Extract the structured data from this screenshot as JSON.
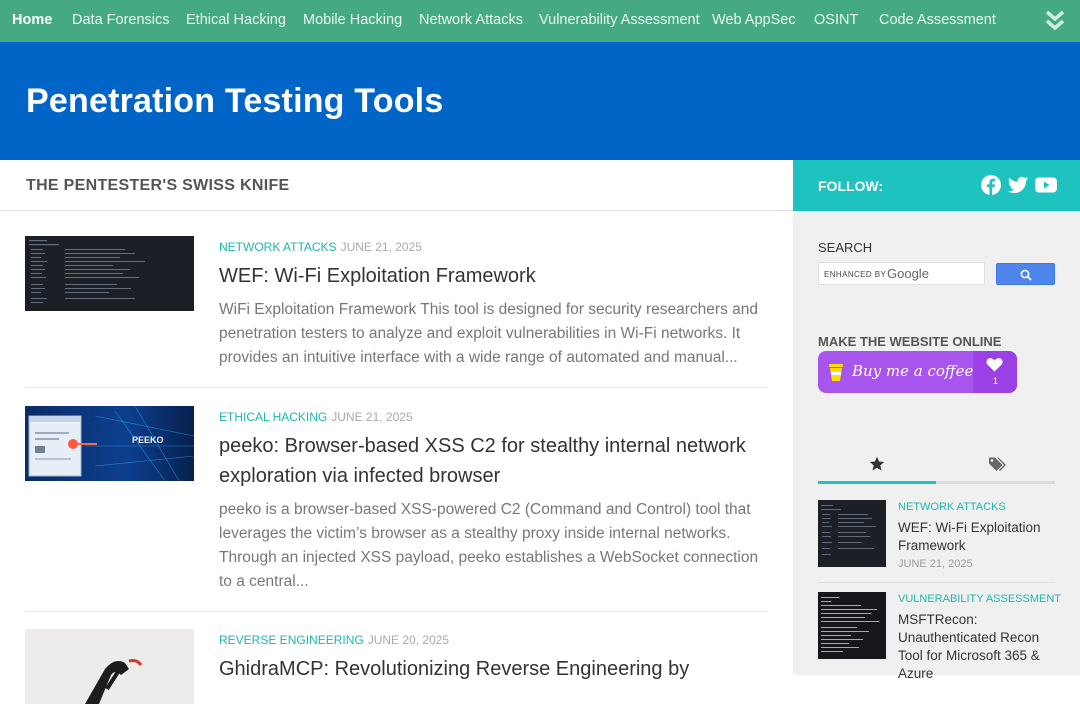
{
  "nav": {
    "items": [
      "Home",
      "Data Forensics",
      "Ethical Hacking",
      "Mobile Hacking",
      "Network Attacks",
      "Vulnerability Assessment",
      "Web AppSec",
      "OSINT",
      "Code Assessment"
    ],
    "more_icon": "double-chevron-down-icon",
    "bar_color": "#45a982"
  },
  "header": {
    "title": "Penetration Testing Tools",
    "bg_color": "#0065c6"
  },
  "main": {
    "tagline": "THE PENTESTER'S SWISS KNIFE",
    "posts": [
      {
        "category": "NETWORK ATTACKS",
        "date": "JUNE 21, 2025",
        "title": "WEF: Wi-Fi Exploitation Framework",
        "excerpt": "WiFi Exploitation Framework This tool is designed for security researchers and penetration testers to analyze and exploit vulnerabilities in Wi-Fi networks. It provides an intuitive interface with a wide range of automated and manual..."
      },
      {
        "category": "ETHICAL HACKING",
        "date": "JUNE 21, 2025",
        "title": "peeko: Browser-based XSS C2 for stealthy internal network exploration via infected browser",
        "excerpt": "peeko is a browser-based XSS-powered C2 (Command and Control) tool that leverages the victim’s browser as a stealthy proxy inside internal networks. Through an injected XSS payload, peeko establishes a WebSocket connection to a central...",
        "thumb_label": "PEEKO"
      },
      {
        "category": "REVERSE ENGINEERING",
        "date": "JUNE 20, 2025",
        "title": "GhidraMCP: Revolutionizing Reverse Engineering by"
      }
    ]
  },
  "sidebar": {
    "follow_label": "FOLLOW:",
    "social_icons": [
      "facebook-icon",
      "twitter-icon",
      "youtube-icon"
    ],
    "search": {
      "title": "SEARCH",
      "enhanced_by": "ENHANCED BY",
      "google": "Google",
      "button_icon": "search-icon"
    },
    "donate": {
      "title": "MAKE THE WEBSITE ONLINE",
      "button_label": "Buy me a coffee",
      "count": "1"
    },
    "tabs": [
      {
        "icon": "star-icon",
        "active": true
      },
      {
        "icon": "tags-icon",
        "active": false
      }
    ],
    "recent": [
      {
        "category": "NETWORK ATTACKS",
        "title": "WEF: Wi-Fi Exploitation Framework",
        "date": "JUNE 21, 2025"
      },
      {
        "category": "VULNERABILITY ASSESSMENT",
        "title": "MSFTRecon: Unauthenticated Recon Tool for Microsoft 365 & Azure"
      }
    ],
    "accent_color": "#1ec3c0"
  }
}
